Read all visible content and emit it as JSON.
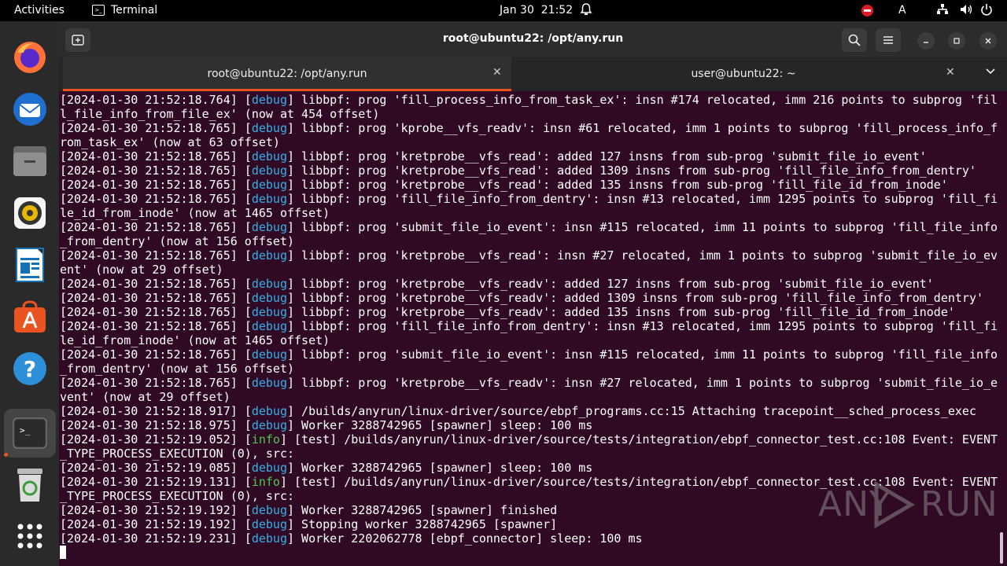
{
  "topbar": {
    "activities": "Activities",
    "app_name": "Terminal",
    "date": "Jan 30",
    "time": "21:52",
    "keyboard_layout": "A"
  },
  "dock": {
    "apps": [
      "firefox-icon",
      "thunderbird-icon",
      "files-icon",
      "rhythmbox-icon",
      "writer-icon",
      "app-center-icon",
      "help-icon",
      "terminal-icon",
      "trash-icon",
      "show-apps-icon"
    ]
  },
  "window": {
    "title": "root@ubuntu22: /opt/any.run",
    "tabs": [
      {
        "label": "root@ubuntu22: /opt/any.run",
        "selected": true
      },
      {
        "label": "user@ubuntu22: ~",
        "selected": false
      }
    ]
  },
  "terminal": {
    "lines": [
      {
        "ts": "[2024-01-30 21:52:18.764] ",
        "level": "debug",
        "msg": " libbpf: prog 'fill_process_info_from_task_ex': insn #174 relocated, imm 216 points to subprog 'fil"
      },
      {
        "ts": "",
        "level": "",
        "msg": "l_file_info_from_file_ex' (now at 454 offset)"
      },
      {
        "ts": "[2024-01-30 21:52:18.765] ",
        "level": "debug",
        "msg": " libbpf: prog 'kprobe__vfs_readv': insn #61 relocated, imm 1 points to subprog 'fill_process_info_f"
      },
      {
        "ts": "",
        "level": "",
        "msg": "rom_task_ex' (now at 63 offset)"
      },
      {
        "ts": "[2024-01-30 21:52:18.765] ",
        "level": "debug",
        "msg": " libbpf: prog 'kretprobe__vfs_read': added 127 insns from sub-prog 'submit_file_io_event'"
      },
      {
        "ts": "[2024-01-30 21:52:18.765] ",
        "level": "debug",
        "msg": " libbpf: prog 'kretprobe__vfs_read': added 1309 insns from sub-prog 'fill_file_info_from_dentry'"
      },
      {
        "ts": "[2024-01-30 21:52:18.765] ",
        "level": "debug",
        "msg": " libbpf: prog 'kretprobe__vfs_read': added 135 insns from sub-prog 'fill_file_id_from_inode'"
      },
      {
        "ts": "[2024-01-30 21:52:18.765] ",
        "level": "debug",
        "msg": " libbpf: prog 'fill_file_info_from_dentry': insn #13 relocated, imm 1295 points to subprog 'fill_fi"
      },
      {
        "ts": "",
        "level": "",
        "msg": "le_id_from_inode' (now at 1465 offset)"
      },
      {
        "ts": "[2024-01-30 21:52:18.765] ",
        "level": "debug",
        "msg": " libbpf: prog 'submit_file_io_event': insn #115 relocated, imm 11 points to subprog 'fill_file_info"
      },
      {
        "ts": "",
        "level": "",
        "msg": "_from_dentry' (now at 156 offset)"
      },
      {
        "ts": "[2024-01-30 21:52:18.765] ",
        "level": "debug",
        "msg": " libbpf: prog 'kretprobe__vfs_read': insn #27 relocated, imm 1 points to subprog 'submit_file_io_ev"
      },
      {
        "ts": "",
        "level": "",
        "msg": "ent' (now at 29 offset)"
      },
      {
        "ts": "[2024-01-30 21:52:18.765] ",
        "level": "debug",
        "msg": " libbpf: prog 'kretprobe__vfs_readv': added 127 insns from sub-prog 'submit_file_io_event'"
      },
      {
        "ts": "[2024-01-30 21:52:18.765] ",
        "level": "debug",
        "msg": " libbpf: prog 'kretprobe__vfs_readv': added 1309 insns from sub-prog 'fill_file_info_from_dentry'"
      },
      {
        "ts": "[2024-01-30 21:52:18.765] ",
        "level": "debug",
        "msg": " libbpf: prog 'kretprobe__vfs_readv': added 135 insns from sub-prog 'fill_file_id_from_inode'"
      },
      {
        "ts": "[2024-01-30 21:52:18.765] ",
        "level": "debug",
        "msg": " libbpf: prog 'fill_file_info_from_dentry': insn #13 relocated, imm 1295 points to subprog 'fill_fi"
      },
      {
        "ts": "",
        "level": "",
        "msg": "le_id_from_inode' (now at 1465 offset)"
      },
      {
        "ts": "[2024-01-30 21:52:18.765] ",
        "level": "debug",
        "msg": " libbpf: prog 'submit_file_io_event': insn #115 relocated, imm 11 points to subprog 'fill_file_info"
      },
      {
        "ts": "",
        "level": "",
        "msg": "_from_dentry' (now at 156 offset)"
      },
      {
        "ts": "[2024-01-30 21:52:18.765] ",
        "level": "debug",
        "msg": " libbpf: prog 'kretprobe__vfs_readv': insn #27 relocated, imm 1 points to subprog 'submit_file_io_e"
      },
      {
        "ts": "",
        "level": "",
        "msg": "vent' (now at 29 offset)"
      },
      {
        "ts": "[2024-01-30 21:52:18.917] ",
        "level": "debug",
        "msg": " /builds/anyrun/linux-driver/source/ebpf_programs.cc:15 Attaching tracepoint__sched_process_exec"
      },
      {
        "ts": "[2024-01-30 21:52:18.975] ",
        "level": "debug",
        "msg": " Worker 3288742965 [spawner] sleep: 100 ms"
      },
      {
        "ts": "[2024-01-30 21:52:19.052] ",
        "level": "info",
        "msg": " [test] /builds/anyrun/linux-driver/source/tests/integration/ebpf_connector_test.cc:108 Event: EVENT"
      },
      {
        "ts": "",
        "level": "",
        "msg": "_TYPE_PROCESS_EXECUTION (0), src:"
      },
      {
        "ts": "[2024-01-30 21:52:19.085] ",
        "level": "debug",
        "msg": " Worker 3288742965 [spawner] sleep: 100 ms"
      },
      {
        "ts": "[2024-01-30 21:52:19.131] ",
        "level": "info",
        "msg": " [test] /builds/anyrun/linux-driver/source/tests/integration/ebpf_connector_test.cc:108 Event: EVENT"
      },
      {
        "ts": "",
        "level": "",
        "msg": "_TYPE_PROCESS_EXECUTION (0), src:"
      },
      {
        "ts": "[2024-01-30 21:52:19.192] ",
        "level": "debug",
        "msg": " Worker 3288742965 [spawner] finished"
      },
      {
        "ts": "[2024-01-30 21:52:19.192] ",
        "level": "debug",
        "msg": " Stopping worker 3288742965 [spawner]"
      },
      {
        "ts": "[2024-01-30 21:52:19.231] ",
        "level": "debug",
        "msg": " Worker 2202062778 [ebpf_connector] sleep: 100 ms"
      }
    ]
  },
  "watermark": {
    "left": "ANY",
    "right": "RUN"
  },
  "colors": {
    "debug": "#34b0e8",
    "info": "#4ec94e",
    "background": "#300a24",
    "accent": "#e95420"
  }
}
